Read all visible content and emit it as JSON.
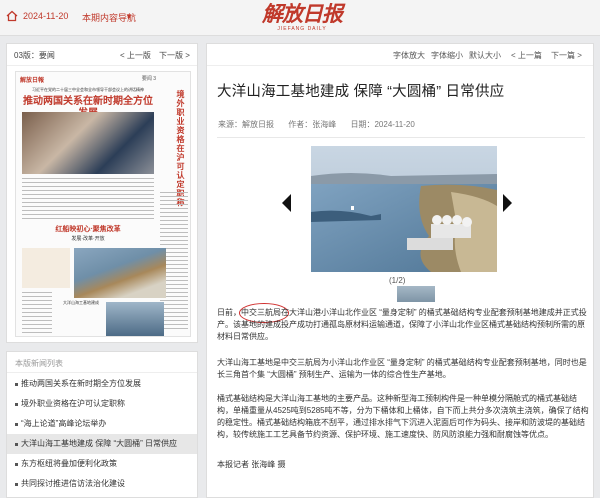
{
  "topbar": {
    "date": "2024-11-20",
    "nav_label": "本期内容导航",
    "logo_text": "解放日报",
    "logo_sub": "JIEFANG DAILY"
  },
  "edition": {
    "label": "03版：要闻",
    "prev": "< 上一版",
    "next": "下一版 >",
    "paper": {
      "tag": "解放日報",
      "page": "要闻 3",
      "lede": "习近平在党的二十届三中全会和全市领导干部会议上的讲话精神",
      "head1": "推动两国关系在新时期全方位发展",
      "vertical": "境外职业资格在沪可认定职称",
      "head2": "红船映初心·聚焦改革",
      "head3": "发展·改革·开放",
      "small_head": "大洋山海工基地建成"
    }
  },
  "list": {
    "title": "本版新闻列表",
    "items": [
      "推动两国关系在新时期全方位发展",
      "境外职业资格在沪可认定职称",
      "“海上论道”高峰论坛举办",
      "大洋山海工基地建成 保障 “大圆桶” 日常供应",
      "东方枢纽将叠加便利化政策",
      "共同探讨推进信访法治化建设"
    ],
    "active_index": 3
  },
  "toolbar": {
    "font_up": "字体放大",
    "font_down": "字体缩小",
    "font_default": "默认大小",
    "prev_article": "< 上一篇",
    "next_article": "下一篇 >"
  },
  "article": {
    "headline": "大洋山海工基地建成 保障 “大圆桶” 日常供应",
    "source": "来源：解放日报",
    "author": "作者：张海峰",
    "date": "日期：2024-11-20",
    "slide_counter": "(1/2)",
    "p1": "日前，中交三航局在大洋山港小洋山北作业区 “量身定制” 的桶式基础结构专业配套预制基地建成并正式投产。该基地的建成投产成功打通孤岛原材料运输通道，保障了小洋山北作业区桶式基础结构预制所需的原材料日常供应。",
    "p2": "大洋山海工基地是中交三航局为小洋山北作业区 “量身定制” 的桶式基础结构专业配套预制基地，同时也是长三角首个集 “大圆桶” 预制生产、运输为一体的综合性生产基地。",
    "p3": "桶式基础结构是大洋山海工基地的主要产品。这种新型海工预制构件是一种单模分隔舱式的桶式基础结构，单桶重量从4525吨到5285吨不等，分为下桶体和上桶体，自下而上共分多次浇筑主浇筑，确保了结构的稳定性。桶式基础结构箱底不刮平，通过排水排气下沉进入泥面后可作为码头、接岸和防波堤的基础结构，较传统施工工艺具备节约资源、保护环境、施工速度快、防风防浪能力强和耐腐蚀等优点。",
    "p4": "本报记者 张海峰 摄"
  }
}
